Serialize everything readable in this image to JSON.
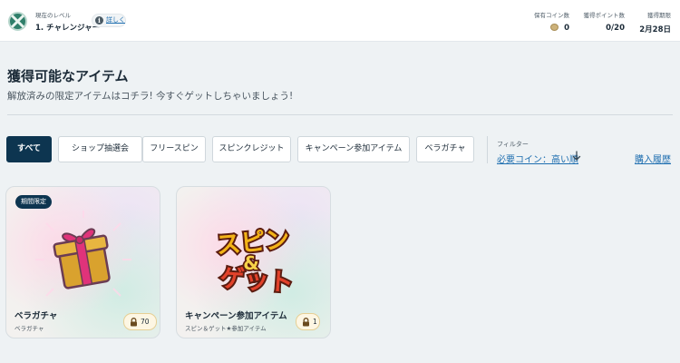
{
  "header": {
    "level_caption": "現在のレベル",
    "level_name": "1. チャレンジャー",
    "detail_link": "詳しく",
    "info_icon": "i",
    "stats": {
      "coins": {
        "label": "保有コイン数",
        "value": "0"
      },
      "points": {
        "label": "獲得ポイント数",
        "value": "0/20"
      },
      "deadline": {
        "label": "獲得期限",
        "value": "2月28日"
      }
    }
  },
  "section": {
    "title": "獲得可能なアイテム",
    "subtitle": "解放済みの限定アイテムはコチラ! 今すぐゲットしちゃいましょう!"
  },
  "tabs": [
    {
      "label": "すべて",
      "active": true
    },
    {
      "label": "ショップ抽選会",
      "active": false
    },
    {
      "label": "フリースピン",
      "active": false
    },
    {
      "label": "スピンクレジット",
      "active": false
    },
    {
      "label": "キャンペーン参加アイテム",
      "active": false
    },
    {
      "label": "ベラガチャ",
      "active": false
    }
  ],
  "filter": {
    "label": "フィルター",
    "selected": "必要コイン：高い順"
  },
  "purchase_history": "購入履歴",
  "cards": [
    {
      "badge": "期間限定",
      "title": "ベラガチャ",
      "subtitle": "ベラガチャ",
      "price": "70",
      "icon": "gift-box-icon"
    },
    {
      "title": "キャンペーン参加アイテム",
      "subtitle": "スピン＆ゲット★参加アイテム",
      "price": "1",
      "art_text": {
        "line1": "スピン",
        "line2": "&",
        "line3": "ゲット"
      },
      "icon": "spin-and-get-logo"
    }
  ],
  "colors": {
    "accent_dark": "#0d3550",
    "link": "#1f6fb0",
    "background": "#eef2f4",
    "price_pill": "#fdf6e3"
  }
}
